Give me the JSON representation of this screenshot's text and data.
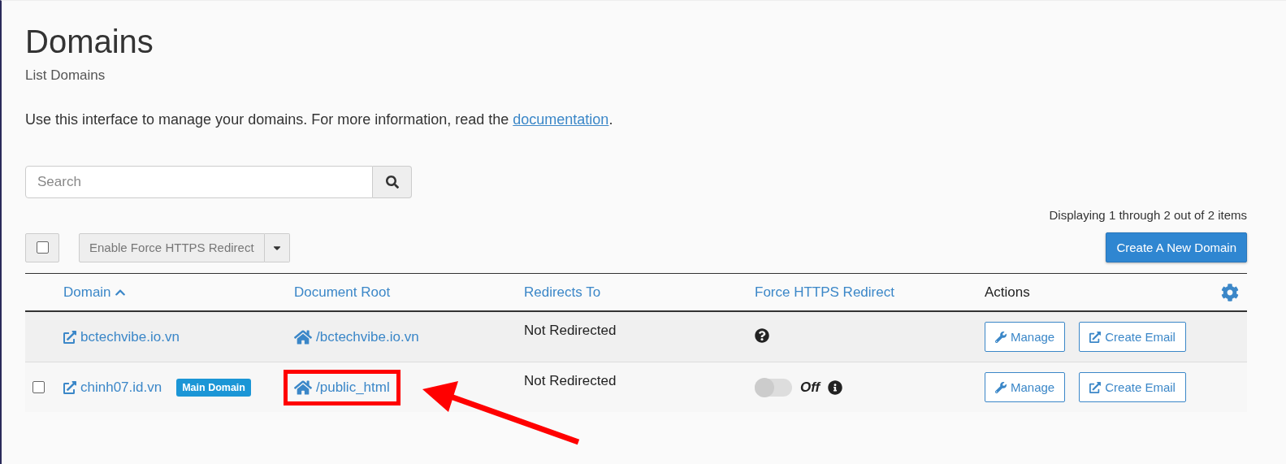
{
  "page": {
    "title": "Domains",
    "subtitle": "List Domains",
    "description_before": "Use this interface to manage your domains. For more information, read the ",
    "description_link": "documentation",
    "description_after": "."
  },
  "search": {
    "placeholder": "Search"
  },
  "paging": "Displaying 1 through 2 out of 2 items",
  "toolbar": {
    "select_all_checked": false,
    "bulk_action": "Enable Force HTTPS Redirect",
    "bulk_disabled": true,
    "create_button": "Create A New Domain"
  },
  "table": {
    "columns": [
      {
        "label": "Domain",
        "sortable": true,
        "sorted": true
      },
      {
        "label": "Document Root",
        "sortable": true,
        "sorted": false
      },
      {
        "label": "Redirects To",
        "sortable": true,
        "sorted": false
      },
      {
        "label": "Force HTTPS Redirect",
        "sortable": true,
        "sorted": false
      },
      {
        "label": "Actions",
        "sortable": false,
        "sorted": false
      }
    ],
    "rows": [
      {
        "domain": "bctechvibe.io.vn",
        "document_root": "/bctechvibe.io.vn",
        "highlighted": false,
        "redirects_to": "Not Redirected",
        "https": {
          "kind": "unknown"
        },
        "actions": [
          "Manage",
          "Create Email"
        ]
      },
      {
        "checked": false,
        "domain": "chinh07.id.vn",
        "badge": "Main Domain",
        "document_root": "/public_html",
        "highlighted": true,
        "redirects_to": "Not Redirected",
        "https": {
          "kind": "toggle",
          "on": false,
          "label": "Off"
        },
        "actions": [
          "Manage",
          "Create Email"
        ]
      }
    ]
  }
}
